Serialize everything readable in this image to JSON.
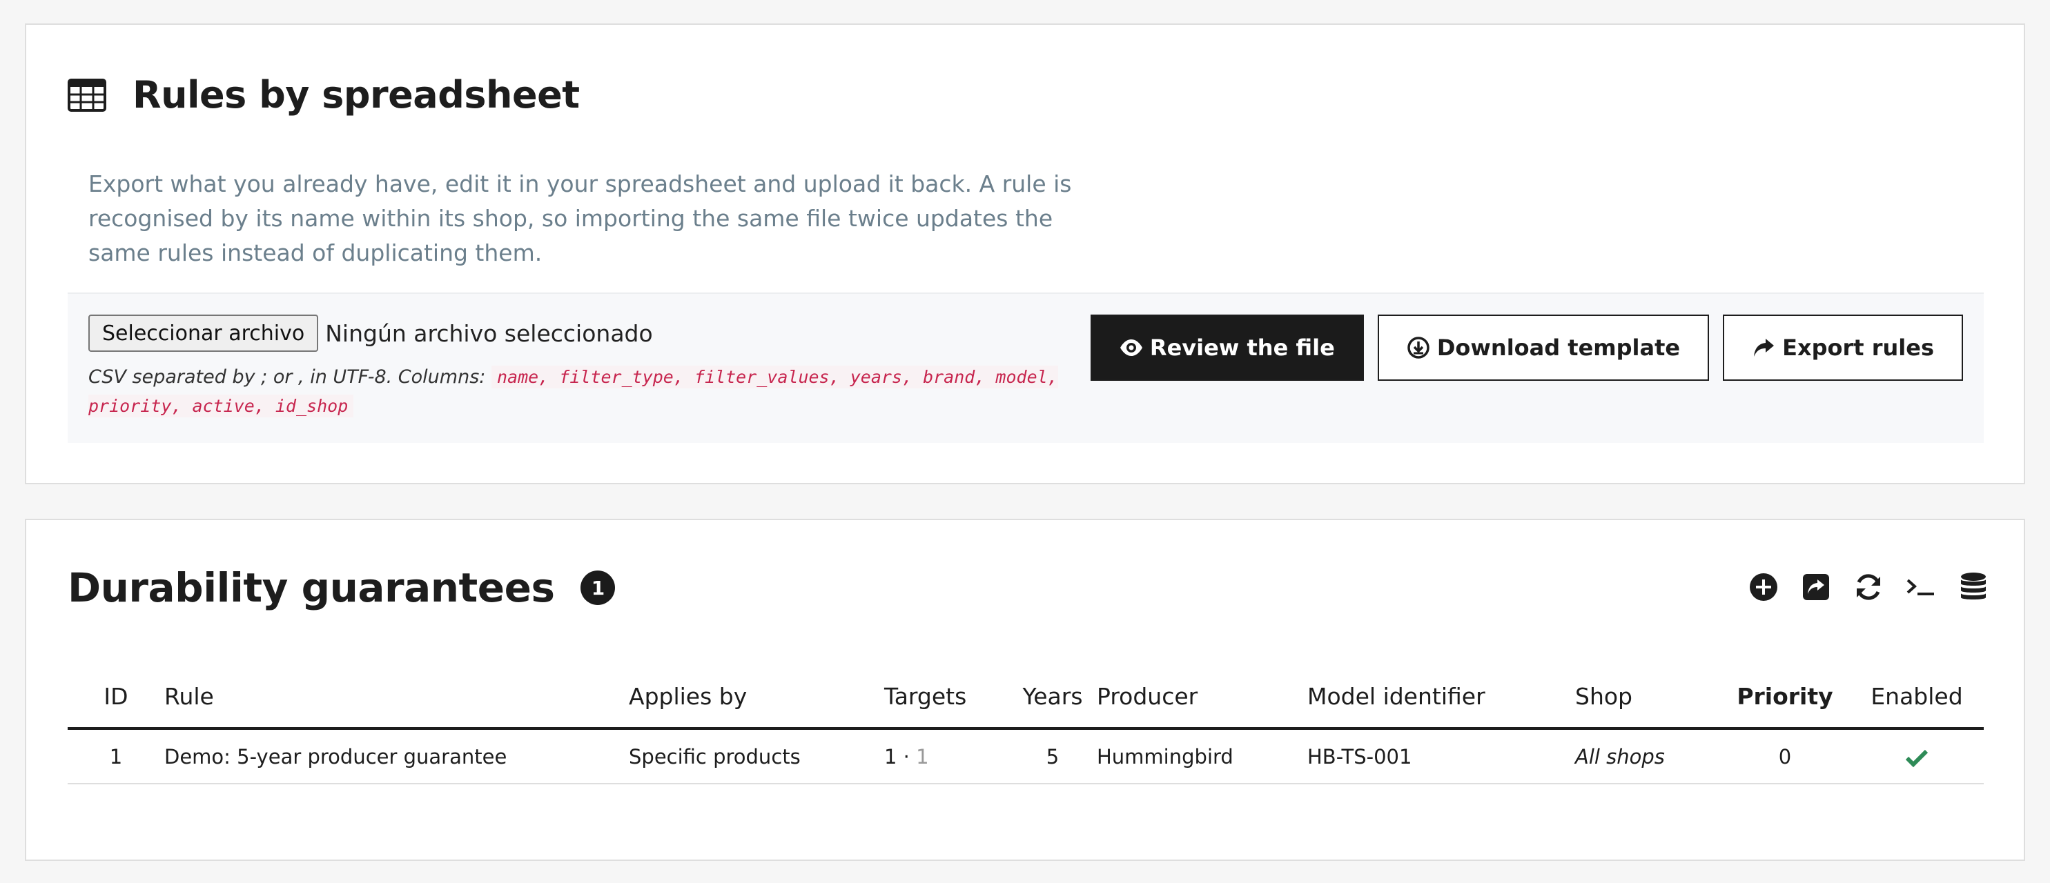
{
  "import_panel": {
    "title": "Rules by spreadsheet",
    "description": "Export what you already have, edit it in your spreadsheet and upload it back. A rule is recognised by its name within its shop, so importing the same file twice updates the same rules instead of duplicating them.",
    "file_button_label": "Seleccionar archivo",
    "file_status": "Ningún archivo seleccionado",
    "csv_help_prefix": "CSV separated by ; or , in UTF-8. Columns:",
    "csv_columns": "name, filter_type, filter_values, years, brand, model, priority, active, id_shop",
    "buttons": {
      "review": "Review the file",
      "download_template": "Download template",
      "export": "Export rules"
    }
  },
  "guarantees": {
    "title": "Durability guarantees",
    "count": "1",
    "columns": {
      "id": "ID",
      "rule": "Rule",
      "applies_by": "Applies by",
      "targets": "Targets",
      "years": "Years",
      "producer": "Producer",
      "model": "Model identifier",
      "shop": "Shop",
      "priority": "Priority",
      "enabled": "Enabled"
    },
    "rows": [
      {
        "id": "1",
        "rule": "Demo: 5-year producer guarantee",
        "applies_by": "Specific products",
        "targets_count": "1",
        "targets_sep": " · ",
        "targets_extra": "1",
        "years": "5",
        "producer": "Hummingbird",
        "model": "HB-TS-001",
        "shop": "All shops",
        "priority": "0",
        "enabled_icon": "check-icon"
      }
    ]
  },
  "colors": {
    "primary_button": "#1b1b1b",
    "description_text": "#6b7f8c",
    "code_text": "#c7254e",
    "enabled_check": "#2e8b57"
  }
}
